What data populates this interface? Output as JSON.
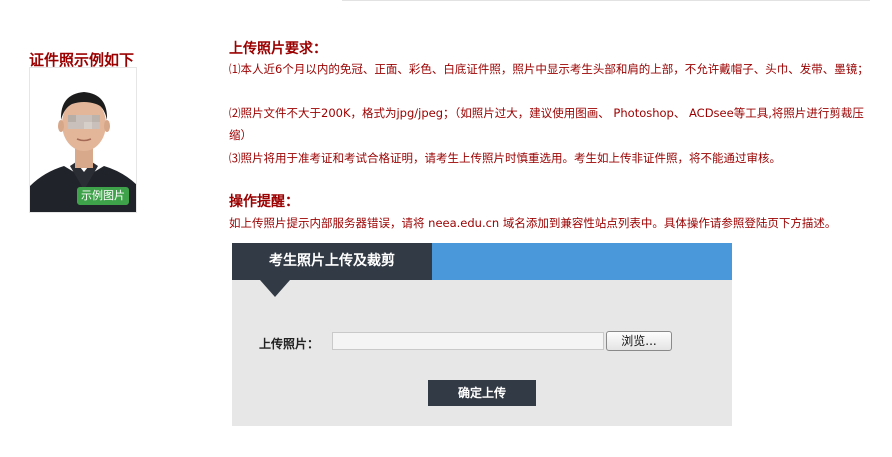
{
  "sample": {
    "title": "证件照示例如下",
    "badge": "示例图片"
  },
  "requirements": {
    "title": "上传照片要求：",
    "item1": "⑴本人近6个月以内的免冠、正面、彩色、白底证件照，照片中显示考生头部和肩的上部，不允许戴帽子、头巾、发带、墨镜；",
    "item2": "⑵照片文件不大于200K，格式为jpg/jpeg；（如照片过大，建议使用图画、 Photoshop、 ACDsee等工具,将照片进行剪裁压缩）",
    "item3": "⑶照片将用于准考证和考试合格证明，请考生上传照片时慎重选用。考生如上传非证件照，将不能通过审核。"
  },
  "tips": {
    "title": "操作提醒：",
    "text": "如上传照片提示内部服务器错误，请将 neea.edu.cn 域名添加到兼容性站点列表中。具体操作请参照登陆页下方描述。"
  },
  "upload_panel": {
    "tab_title": "考生照片上传及裁剪",
    "field_label": "上传照片：",
    "file_value": "",
    "browse_label": "浏览...",
    "submit_label": "确定上传"
  },
  "colors": {
    "accent_red": "#9b0000",
    "panel_dark": "#323a45",
    "panel_blue": "#4a97d9",
    "panel_bg": "#e7e7e7",
    "badge_green": "#3ea24a"
  }
}
